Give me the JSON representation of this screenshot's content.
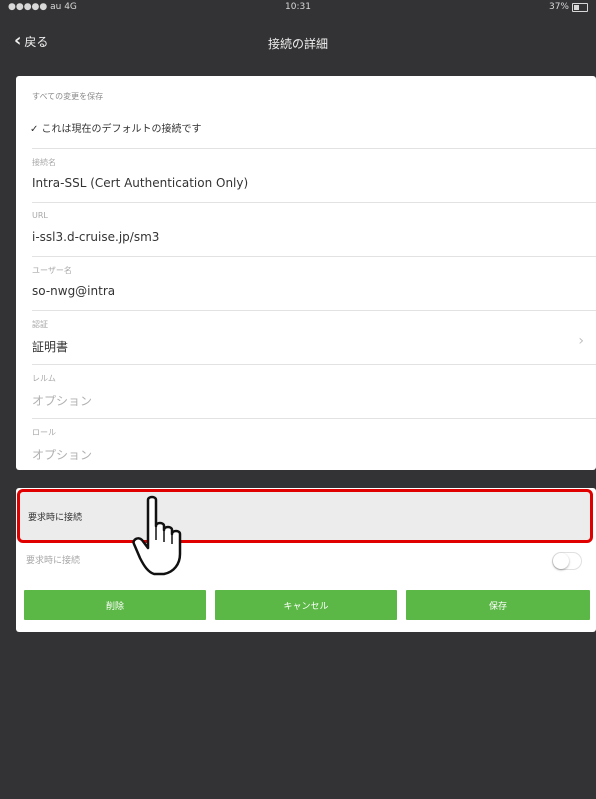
{
  "status_bar": {
    "carrier": "●●●●● au 4G",
    "time": "10:31",
    "battery": "37%"
  },
  "nav": {
    "back_label": "戻る",
    "title": "接続の詳細"
  },
  "details": {
    "save_all": "すべての変更を保存",
    "default_note": "✓ これは現在のデフォルトの接続です",
    "fields": [
      {
        "label": "接続名",
        "value": "Intra-SSL (Cert Authentication Only)"
      },
      {
        "label": "URL",
        "value": "i-ssl3.d-cruise.jp/sm3"
      },
      {
        "label": "ユーザー名",
        "value": "so-nwg@intra"
      },
      {
        "label": "認証",
        "value": "証明書"
      },
      {
        "label": "レルム",
        "value": "オプション"
      },
      {
        "label": "ロール",
        "value": "オプション"
      }
    ]
  },
  "on_demand": {
    "header": "要求時に接続",
    "toggle_label": "要求時に接続",
    "toggle_on": false
  },
  "buttons": {
    "delete": "削除",
    "cancel": "キャンセル",
    "save": "保存"
  },
  "colors": {
    "button_green": "#5cb846",
    "highlight_red": "#e00000",
    "background": "#333335"
  }
}
